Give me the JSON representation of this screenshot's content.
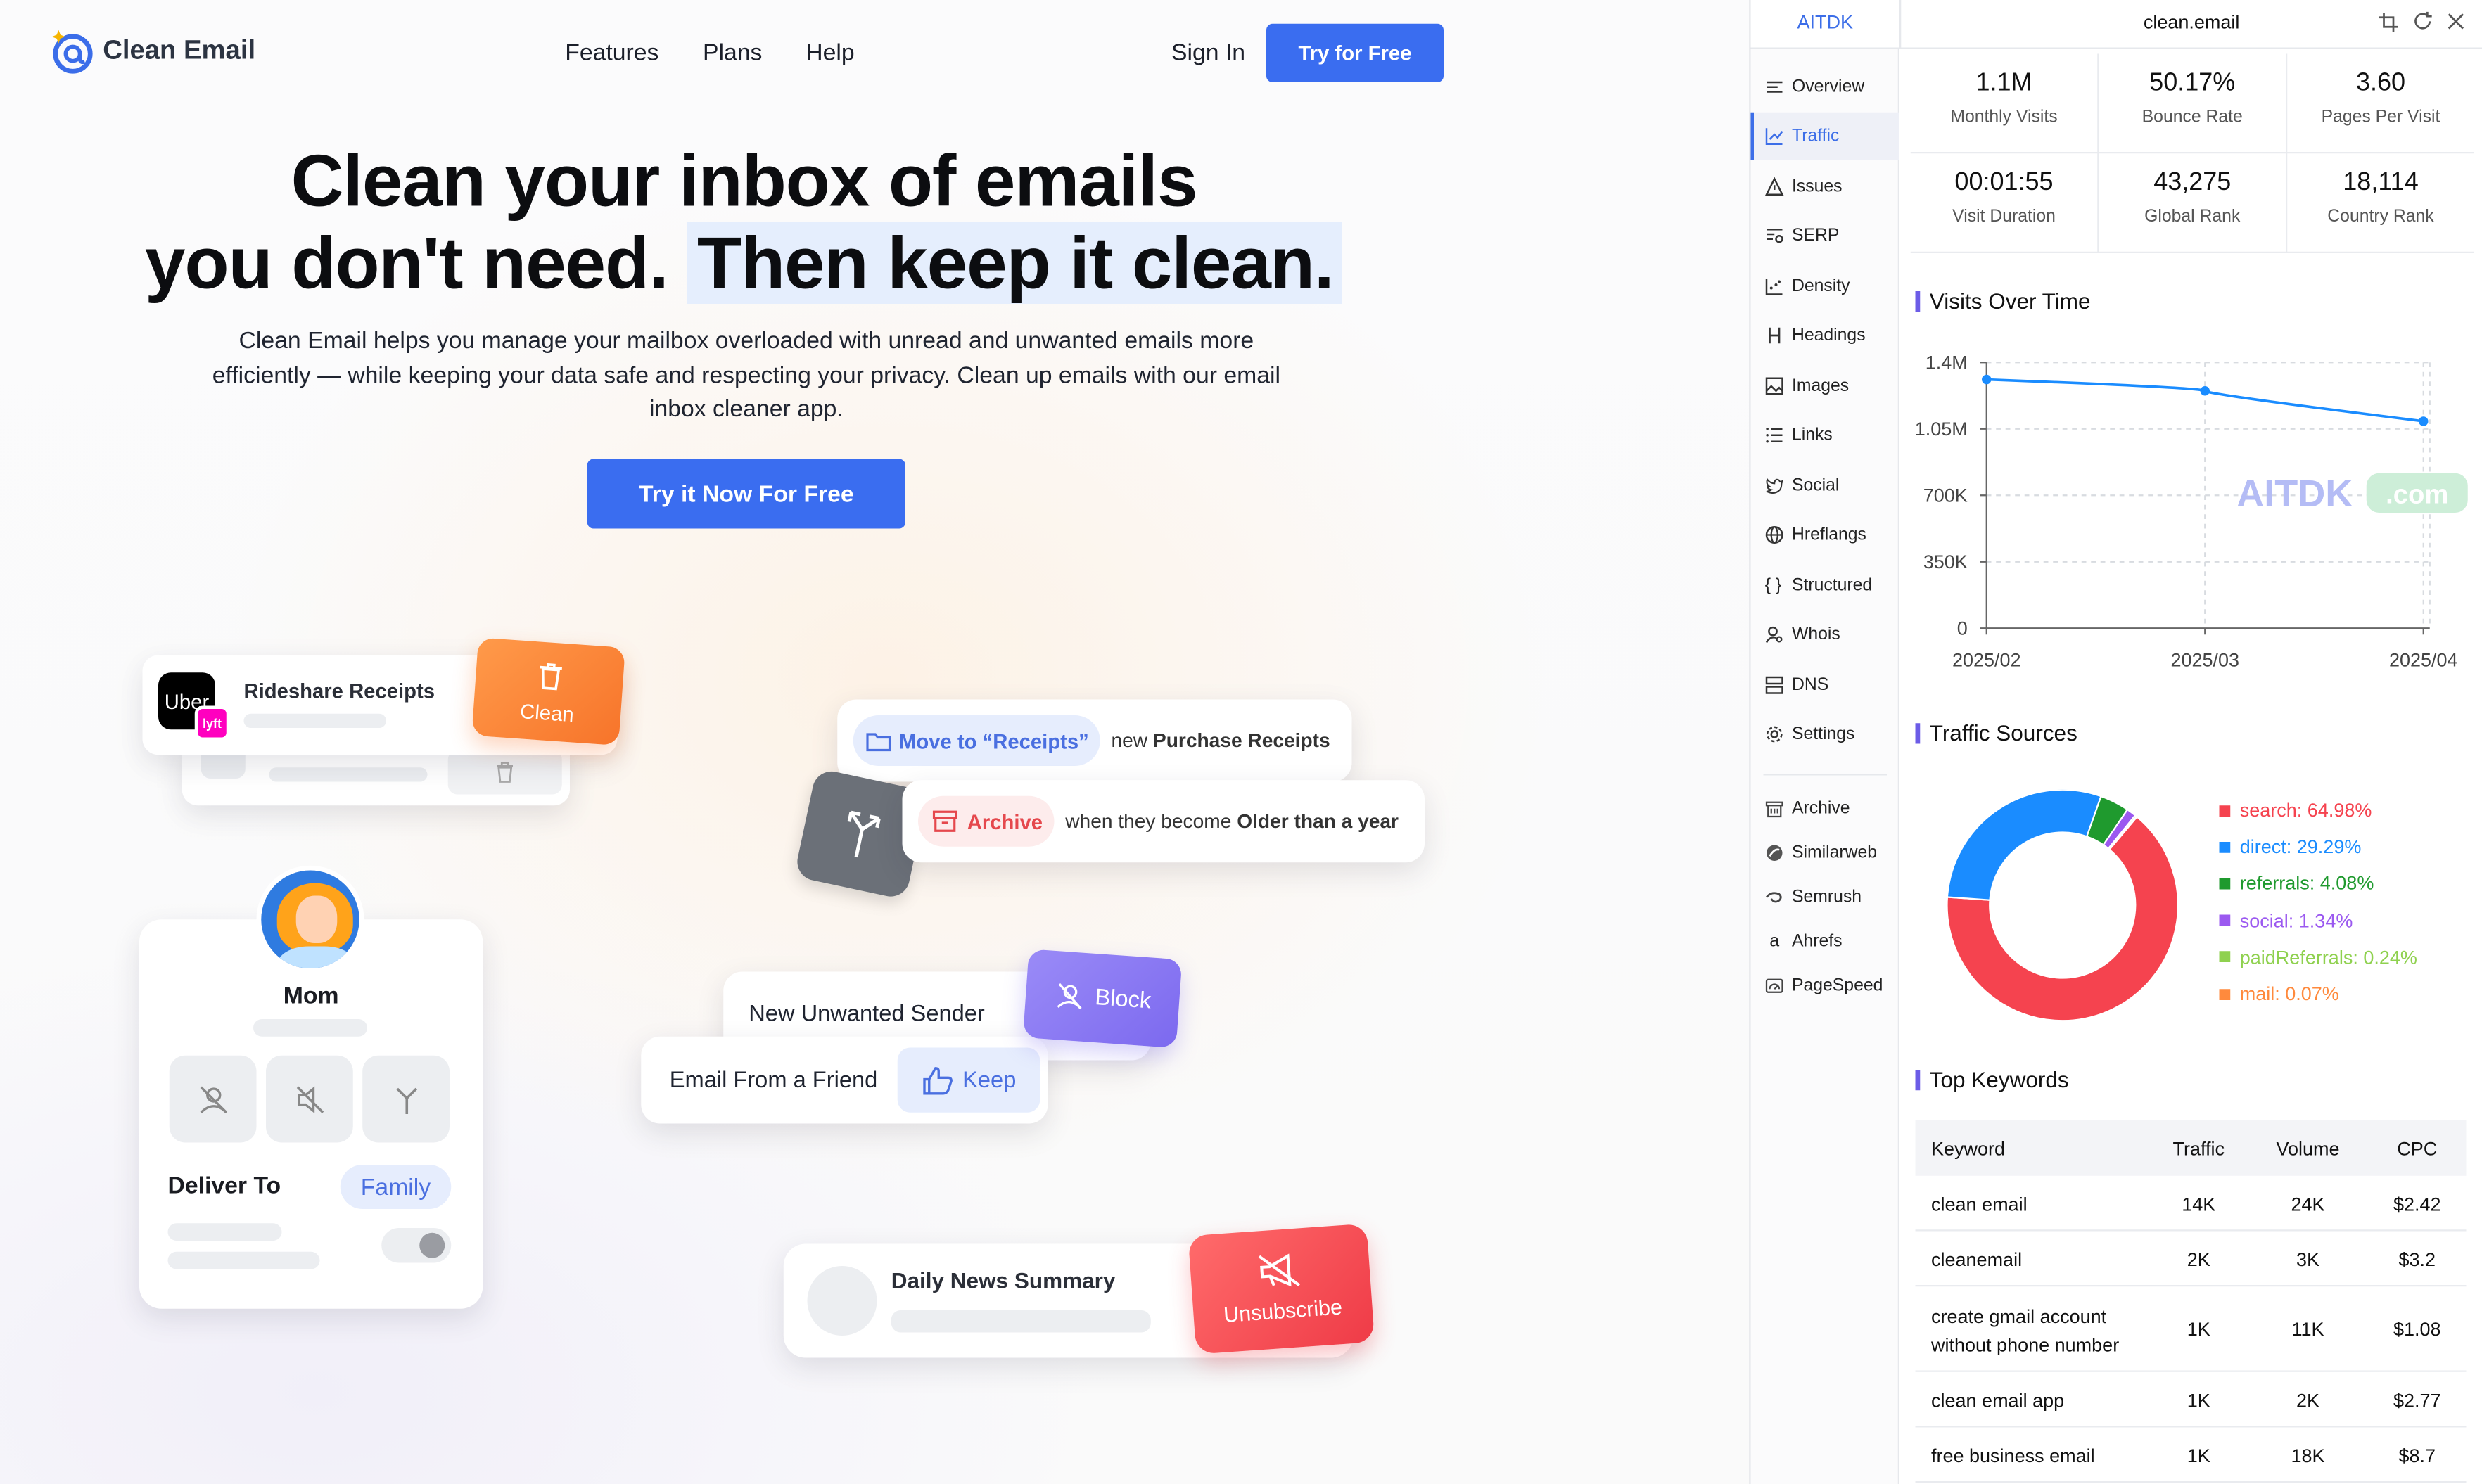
{
  "site": {
    "brand": "Clean Email",
    "nav": [
      "Features",
      "Plans",
      "Help"
    ],
    "sign_in": "Sign In",
    "try_free": "Try for Free",
    "hero_line1": "Clean your inbox of emails",
    "hero_line2a": "you don't need.",
    "hero_line2b": "Then keep it clean.",
    "hero_sub": "Clean Email helps you manage your mailbox overloaded with unread and unwanted emails more efficiently — while keeping your data safe and respecting your privacy. Clean up emails with our email inbox cleaner app.",
    "cta": "Try it Now For Free",
    "rideshare": {
      "uber": "Uber",
      "lyft": "lyft",
      "title": "Rideshare Receipts",
      "clean": "Clean"
    },
    "rule1": {
      "move": "Move to “Receipts”",
      "pre": "new",
      "bold": "Purchase Receipts"
    },
    "rule2": {
      "archive": "Archive",
      "pre": "when they become",
      "bold": "Older than a year"
    },
    "mom": {
      "name": "Mom",
      "deliver": "Deliver To",
      "family": "Family"
    },
    "block": {
      "text": "New Unwanted Sender",
      "btn": "Block"
    },
    "keep": {
      "text": "Email From a Friend",
      "btn": "Keep"
    },
    "news": {
      "text": "Daily News Summary",
      "btn": "Unsubscribe"
    }
  },
  "panel": {
    "brand": "AITDK",
    "domain": "clean.email",
    "nav": [
      "Overview",
      "Traffic",
      "Issues",
      "SERP",
      "Density",
      "Headings",
      "Images",
      "Links",
      "Social",
      "Hreflangs",
      "Structured",
      "Whois",
      "DNS",
      "Settings"
    ],
    "ext_links": [
      "Archive",
      "Similarweb",
      "Semrush",
      "Ahrefs",
      "PageSpeed"
    ],
    "stats": [
      {
        "value": "1.1M",
        "label": "Monthly Visits"
      },
      {
        "value": "50.17%",
        "label": "Bounce Rate"
      },
      {
        "value": "3.60",
        "label": "Pages Per Visit"
      },
      {
        "value": "00:01:55",
        "label": "Visit Duration"
      },
      {
        "value": "43,275",
        "label": "Global Rank"
      },
      {
        "value": "18,114",
        "label": "Country Rank"
      }
    ],
    "visits_title": "Visits Over Time",
    "watermark": "AITDK",
    "watermark_com": ".com",
    "sources_title": "Traffic Sources",
    "keywords_title": "Top Keywords",
    "kw_headers": [
      "Keyword",
      "Traffic",
      "Volume",
      "CPC"
    ],
    "keywords": [
      {
        "kw": "clean email",
        "traffic": "14K",
        "volume": "24K",
        "cpc": "$2.42"
      },
      {
        "kw": "cleanemail",
        "traffic": "2K",
        "volume": "3K",
        "cpc": "$3.2"
      },
      {
        "kw": "create gmail account without phone number",
        "traffic": "1K",
        "volume": "11K",
        "cpc": "$1.08"
      },
      {
        "kw": "clean email app",
        "traffic": "1K",
        "volume": "2K",
        "cpc": "$2.77"
      },
      {
        "kw": "free business email",
        "traffic": "1K",
        "volume": "18K",
        "cpc": "$8.7"
      }
    ]
  },
  "chart_data": [
    {
      "type": "line",
      "title": "Visits Over Time",
      "x": [
        "2025/02",
        "2025/03",
        "2025/04"
      ],
      "series": [
        {
          "values": [
            1310000,
            1250000,
            1090000
          ]
        }
      ],
      "yticks": [
        "0",
        "350K",
        "700K",
        "1.05M",
        "1.4M"
      ],
      "ylim": [
        0,
        1400000
      ],
      "grid": true,
      "color": "#1a8cff"
    },
    {
      "type": "pie",
      "title": "Traffic Sources",
      "labels": [
        "search",
        "direct",
        "referrals",
        "social",
        "paidReferrals",
        "mail"
      ],
      "values": [
        64.98,
        29.29,
        4.08,
        1.34,
        0.24,
        0.07
      ],
      "display": [
        "search: 64.98%",
        "direct: 29.29%",
        "referrals: 4.08%",
        "social: 1.34%",
        "paidReferrals: 0.24%",
        "mail: 0.07%"
      ],
      "colors": [
        "#f5434f",
        "#1a8cff",
        "#1f9a2e",
        "#9b59f0",
        "#8fd14f",
        "#ff8a3d"
      ],
      "legend": "right"
    }
  ]
}
